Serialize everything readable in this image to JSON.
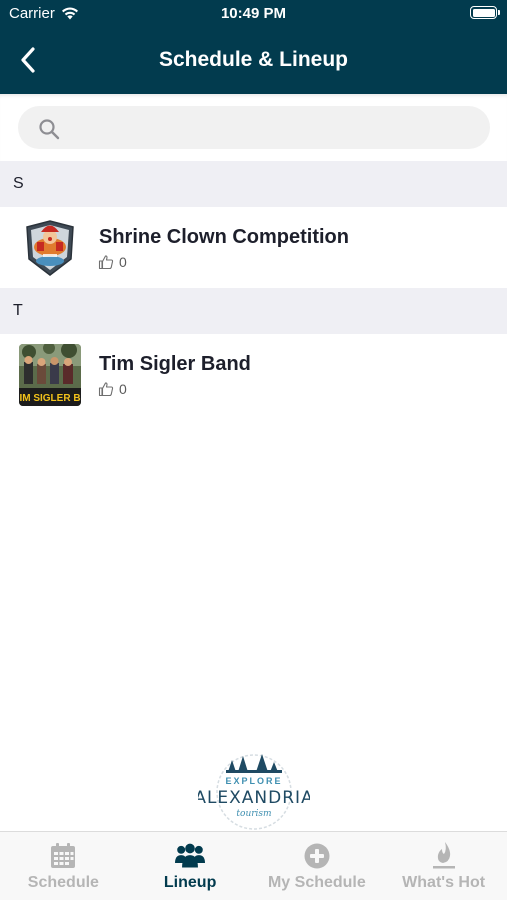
{
  "status_bar": {
    "carrier": "Carrier",
    "time": "10:49 PM"
  },
  "header": {
    "title": "Schedule & Lineup"
  },
  "search": {
    "placeholder": ""
  },
  "sections": [
    {
      "letter": "S",
      "items": [
        {
          "title": "Shrine Clown Competition",
          "likes": "0"
        }
      ]
    },
    {
      "letter": "T",
      "items": [
        {
          "title": "Tim Sigler Band",
          "likes": "0",
          "thumb_text": "IM SIGLER B"
        }
      ]
    }
  ],
  "logo": {
    "top": "EXPLORE",
    "main": "ALEXANDRIA",
    "sub": "tourism"
  },
  "tabs": [
    {
      "label": "Schedule",
      "icon": "calendar-icon",
      "active": false
    },
    {
      "label": "Lineup",
      "icon": "people-icon",
      "active": true
    },
    {
      "label": "My Schedule",
      "icon": "plus-circle-icon",
      "active": false
    },
    {
      "label": "What's Hot",
      "icon": "flame-icon",
      "active": false
    }
  ],
  "colors": {
    "header": "#023b4e",
    "active_tab": "#023b4e",
    "inactive_tab": "#b5b5b5",
    "section_bg": "#efeff4"
  }
}
